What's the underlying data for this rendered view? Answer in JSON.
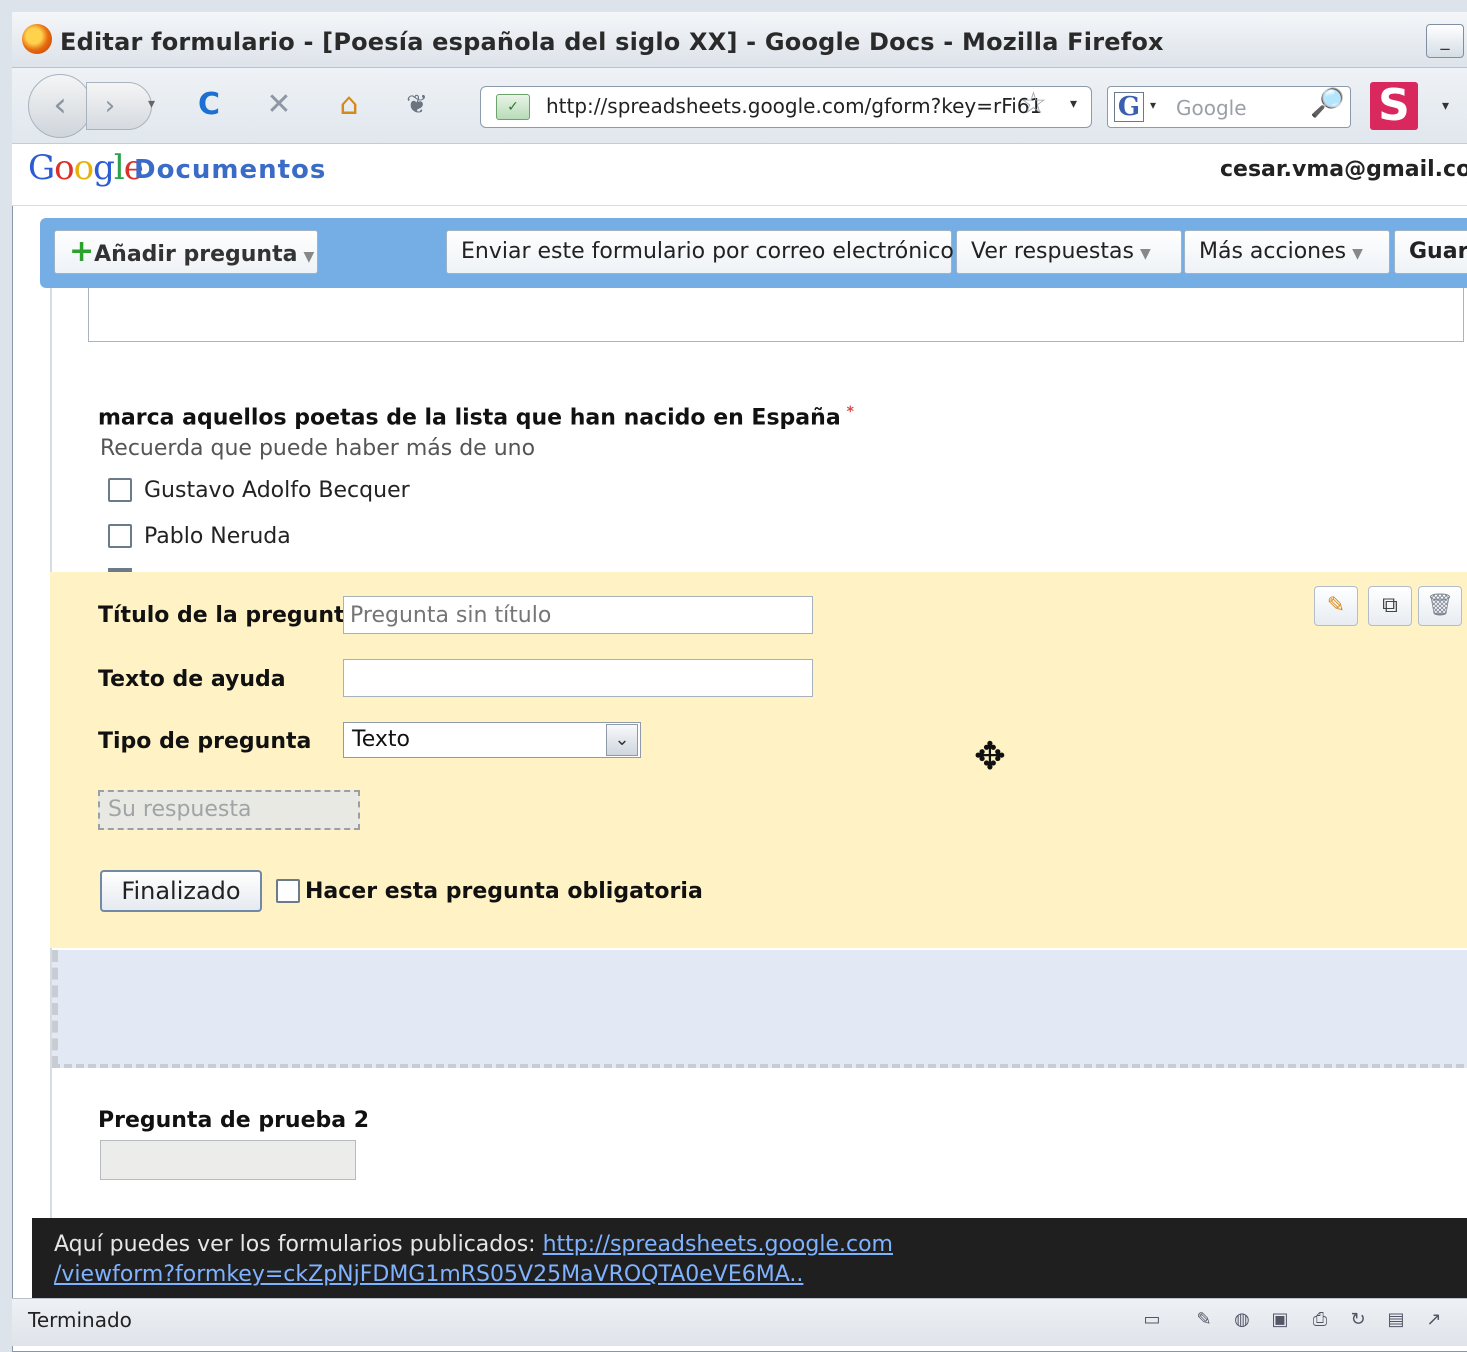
{
  "window": {
    "title": "Editar formulario - [Poesía española del siglo XX] - Google Docs - Mozilla Firefox",
    "minimize_label": "_"
  },
  "navbar": {
    "back": "‹",
    "forward": "›",
    "history": "▾",
    "reload": "C",
    "stop": "✕",
    "home": "⌂",
    "tools": "❦",
    "url": "http://spreadsheets.google.com/gform?key=rFi61",
    "star": "☆",
    "url_dropdown": "▾",
    "search_engine": "G",
    "search_dropdown": "▾",
    "search_placeholder": "Google",
    "search_icon": "🔎",
    "s_logo": "S",
    "s_dropdown": "▾"
  },
  "header": {
    "logo_google": [
      "G",
      "o",
      "o",
      "g",
      "l",
      "e"
    ],
    "logo_colors": [
      "#2c5bd6",
      "#d8322a",
      "#e6b20a",
      "#2c5bd6",
      "#2ba14b",
      "#d8322a"
    ],
    "logo_docs": "Documentos",
    "user_email": "cesar.vma@gmail.com"
  },
  "toolbar": {
    "add_question": "Añadir pregunta",
    "send_form": "Enviar este formulario por correo electrónico",
    "view_responses": "Ver respuestas",
    "more_actions": "Más acciones",
    "save": "Guardar"
  },
  "question1": {
    "title": "marca aquellos poetas de la lista que han nacido en España",
    "required_mark": "*",
    "help": "Recuerda que puede haber más de uno",
    "options": [
      "Gustavo Adolfo Becquer",
      "Pablo Neruda"
    ]
  },
  "editor": {
    "title_label": "Título de la pregunta",
    "title_placeholder": "Pregunta sin título",
    "help_label": "Texto de ayuda",
    "help_value": "",
    "type_label": "Tipo de pregunta",
    "type_value": "Texto",
    "preview_placeholder": "Su respuesta",
    "done_button": "Finalizado",
    "required_label": "Hacer esta pregunta obligatoria",
    "required_checked": false
  },
  "question2": {
    "title": "Pregunta de prueba 2"
  },
  "notice": {
    "text": "Aquí puedes ver los formularios publicados: ",
    "link_line1": "http://spreadsheets.google.com",
    "link_line2": "/viewform?formkey=ckZpNjFDMG1mRS05V25MaVROQTA0eVE6MA.."
  },
  "status": {
    "text": "Terminado"
  }
}
